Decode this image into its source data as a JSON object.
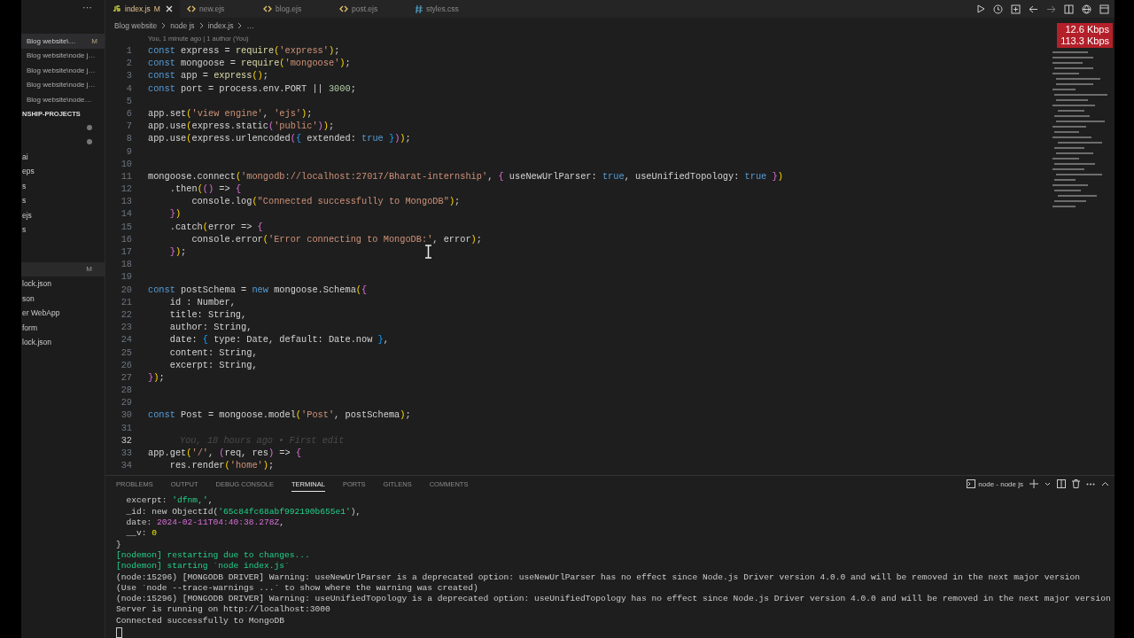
{
  "sidebar": {
    "more": "···",
    "open_editors": [
      {
        "label": "Blog website\\…",
        "badge": "M",
        "selected": true
      },
      {
        "label": "Blog website\\node j…",
        "selected": false
      },
      {
        "label": "Blog website\\node j…",
        "selected": false
      },
      {
        "label": "Blog website\\node j…",
        "selected": false
      },
      {
        "label": "Blog website\\node…",
        "selected": false
      }
    ],
    "section": "NSHIP-PROJECTS",
    "items": [
      {
        "kind": "dot"
      },
      {
        "kind": "dot"
      },
      {
        "kind": "file",
        "label": "ai"
      },
      {
        "kind": "file",
        "label": "eps"
      },
      {
        "kind": "file",
        "label": "s"
      },
      {
        "kind": "file",
        "label": "s"
      },
      {
        "kind": "file",
        "label": "ejs"
      },
      {
        "kind": "file",
        "label": "s"
      },
      {
        "kind": "header",
        "badge": "M"
      },
      {
        "kind": "file",
        "label": "lock.json"
      },
      {
        "kind": "file",
        "label": "son"
      },
      {
        "kind": "file",
        "label": "er WebApp"
      },
      {
        "kind": "file",
        "label": "form"
      },
      {
        "kind": "file",
        "label": "lock.json"
      }
    ]
  },
  "tabs": [
    {
      "label": "index.js",
      "kind": "js",
      "badge": "M",
      "selected": true
    },
    {
      "label": "new.ejs",
      "kind": "ejs",
      "selected": false
    },
    {
      "label": "blog.ejs",
      "kind": "ejs",
      "selected": false
    },
    {
      "label": "post.ejs",
      "kind": "ejs",
      "selected": false
    },
    {
      "label": "styles.css",
      "kind": "css",
      "selected": false
    }
  ],
  "breadcrumb": [
    "Blog website",
    "node js",
    "index.js",
    "…"
  ],
  "codelens": "You, 1 minute ago | 1 author (You)",
  "code": [
    {
      "n": "1",
      "t": [
        {
          "kind": "kw",
          "text": "const "
        },
        {
          "kind": "v",
          "text": "express"
        },
        {
          "kind": "p",
          "text": " = "
        },
        {
          "kind": "fn",
          "text": "require"
        },
        {
          "kind": "b",
          "text": "("
        },
        {
          "kind": "s",
          "text": "'express'"
        },
        {
          "kind": "b",
          "text": ")"
        },
        {
          "kind": "p",
          "text": ";"
        }
      ]
    },
    {
      "n": "2",
      "t": [
        {
          "kind": "kw",
          "text": "const "
        },
        {
          "kind": "v",
          "text": "mongoose"
        },
        {
          "kind": "p",
          "text": " = "
        },
        {
          "kind": "fn",
          "text": "require"
        },
        {
          "kind": "b",
          "text": "("
        },
        {
          "kind": "s",
          "text": "'mongoose'"
        },
        {
          "kind": "b",
          "text": ")"
        },
        {
          "kind": "p",
          "text": ";"
        }
      ]
    },
    {
      "n": "3",
      "t": [
        {
          "kind": "kw",
          "text": "const "
        },
        {
          "kind": "v",
          "text": "app"
        },
        {
          "kind": "p",
          "text": " = "
        },
        {
          "kind": "fn",
          "text": "express"
        },
        {
          "kind": "b",
          "text": "()"
        },
        {
          "kind": "p",
          "text": ";"
        }
      ]
    },
    {
      "n": "4",
      "t": [
        {
          "kind": "kw",
          "text": "const "
        },
        {
          "kind": "v",
          "text": "port"
        },
        {
          "kind": "p",
          "text": " = process.env.PORT || "
        },
        {
          "kind": "num",
          "text": "3000"
        },
        {
          "kind": "p",
          "text": ";"
        }
      ]
    },
    {
      "n": "5"
    },
    {
      "n": "6",
      "t": [
        {
          "kind": "p",
          "text": "app.set"
        },
        {
          "kind": "b",
          "text": "("
        },
        {
          "kind": "s",
          "text": "'view engine'"
        },
        {
          "kind": "p",
          "text": ", "
        },
        {
          "kind": "s",
          "text": "'ejs'"
        },
        {
          "kind": "b",
          "text": ")"
        },
        {
          "kind": "p",
          "text": ";"
        }
      ]
    },
    {
      "n": "7",
      "t": [
        {
          "kind": "p",
          "text": "app.use"
        },
        {
          "kind": "b",
          "text": "("
        },
        {
          "kind": "p",
          "text": "express.static"
        },
        {
          "kind": "pk",
          "text": "("
        },
        {
          "kind": "s",
          "text": "'public'"
        },
        {
          "kind": "pk",
          "text": ")"
        },
        {
          "kind": "b",
          "text": ")"
        },
        {
          "kind": "p",
          "text": ";"
        }
      ]
    },
    {
      "n": "8",
      "t": [
        {
          "kind": "p",
          "text": "app.use"
        },
        {
          "kind": "b",
          "text": "("
        },
        {
          "kind": "p",
          "text": "express.urlencoded"
        },
        {
          "kind": "pk",
          "text": "("
        },
        {
          "kind": "bl",
          "text": "{"
        },
        {
          "kind": "p",
          "text": " extended: "
        },
        {
          "kind": "kw",
          "text": "true"
        },
        {
          "kind": "bl",
          "text": " }"
        },
        {
          "kind": "pk",
          "text": ")"
        },
        {
          "kind": "b",
          "text": ")"
        },
        {
          "kind": "p",
          "text": ";"
        }
      ]
    },
    {
      "n": "9"
    },
    {
      "n": "10"
    },
    {
      "n": "11",
      "t": [
        {
          "kind": "p",
          "text": "mongoose.connect"
        },
        {
          "kind": "b",
          "text": "("
        },
        {
          "kind": "s",
          "text": "'mongodb://localhost:27017/Bharat-internship'"
        },
        {
          "kind": "p",
          "text": ", "
        },
        {
          "kind": "pk",
          "text": "{"
        },
        {
          "kind": "p",
          "text": " useNewUrlParser: "
        },
        {
          "kind": "kw",
          "text": "true"
        },
        {
          "kind": "p",
          "text": ", useUnifiedTopology: "
        },
        {
          "kind": "kw",
          "text": "true"
        },
        {
          "kind": "pk",
          "text": " }"
        },
        {
          "kind": "b",
          "text": ")"
        }
      ]
    },
    {
      "n": "12",
      "t": [
        {
          "kind": "p",
          "text": "    .then"
        },
        {
          "kind": "b",
          "text": "("
        },
        {
          "kind": "pk",
          "text": "()"
        },
        {
          "kind": "p",
          "text": " => "
        },
        {
          "kind": "pk",
          "text": "{"
        }
      ]
    },
    {
      "n": "13",
      "t": [
        {
          "kind": "p",
          "text": "        console.log"
        },
        {
          "kind": "b",
          "text": "("
        },
        {
          "kind": "s",
          "text": "\"Connected successfully to MongoDB\""
        },
        {
          "kind": "b",
          "text": ")"
        },
        {
          "kind": "p",
          "text": ";"
        }
      ]
    },
    {
      "n": "14",
      "t": [
        {
          "kind": "pk",
          "text": "    }"
        },
        {
          "kind": "b",
          "text": ")"
        }
      ]
    },
    {
      "n": "15",
      "t": [
        {
          "kind": "p",
          "text": "    .catch"
        },
        {
          "kind": "b",
          "text": "("
        },
        {
          "kind": "p",
          "text": "error => "
        },
        {
          "kind": "pk",
          "text": "{"
        }
      ]
    },
    {
      "n": "16",
      "t": [
        {
          "kind": "p",
          "text": "        console.error"
        },
        {
          "kind": "b",
          "text": "("
        },
        {
          "kind": "s",
          "text": "'Error connecting to MongoDB:'"
        },
        {
          "kind": "p",
          "text": ", error"
        },
        {
          "kind": "b",
          "text": ")"
        },
        {
          "kind": "p",
          "text": ";"
        }
      ]
    },
    {
      "n": "17",
      "t": [
        {
          "kind": "pk",
          "text": "    }"
        },
        {
          "kind": "b",
          "text": ")"
        },
        {
          "kind": "p",
          "text": ";"
        }
      ]
    },
    {
      "n": "18"
    },
    {
      "n": "19"
    },
    {
      "n": "20",
      "t": [
        {
          "kind": "kw",
          "text": "const "
        },
        {
          "kind": "v",
          "text": "postSchema"
        },
        {
          "kind": "p",
          "text": " = "
        },
        {
          "kind": "kw",
          "text": "new "
        },
        {
          "kind": "p",
          "text": "mongoose.Schema"
        },
        {
          "kind": "b",
          "text": "("
        },
        {
          "kind": "pk",
          "text": "{"
        }
      ]
    },
    {
      "n": "21",
      "t": [
        {
          "kind": "p",
          "text": "    id : Number,"
        }
      ]
    },
    {
      "n": "22",
      "t": [
        {
          "kind": "p",
          "text": "    title: String,"
        }
      ]
    },
    {
      "n": "23",
      "t": [
        {
          "kind": "p",
          "text": "    author: String,"
        }
      ]
    },
    {
      "n": "24",
      "t": [
        {
          "kind": "p",
          "text": "    date: "
        },
        {
          "kind": "bl",
          "text": "{"
        },
        {
          "kind": "p",
          "text": " type: Date, default: Date.now "
        },
        {
          "kind": "bl",
          "text": "}"
        },
        {
          "kind": "p",
          "text": ","
        }
      ]
    },
    {
      "n": "25",
      "t": [
        {
          "kind": "p",
          "text": "    content: String,"
        }
      ]
    },
    {
      "n": "26",
      "t": [
        {
          "kind": "p",
          "text": "    excerpt: String,"
        }
      ]
    },
    {
      "n": "27",
      "t": [
        {
          "kind": "pk",
          "text": "}"
        },
        {
          "kind": "b",
          "text": ")"
        },
        {
          "kind": "p",
          "text": ";"
        }
      ]
    },
    {
      "n": "28"
    },
    {
      "n": "29"
    },
    {
      "n": "30",
      "t": [
        {
          "kind": "kw",
          "text": "const "
        },
        {
          "kind": "v",
          "text": "Post"
        },
        {
          "kind": "p",
          "text": " = mongoose.model"
        },
        {
          "kind": "b",
          "text": "("
        },
        {
          "kind": "s",
          "text": "'Post'"
        },
        {
          "kind": "p",
          "text": ", postSchema"
        },
        {
          "kind": "b",
          "text": ")"
        },
        {
          "kind": "p",
          "text": ";"
        }
      ]
    },
    {
      "n": "31"
    },
    {
      "n": "32",
      "blame": "You, 18 hours ago • First edit",
      "current": true
    },
    {
      "n": "33",
      "t": [
        {
          "kind": "p",
          "text": "app.get"
        },
        {
          "kind": "b",
          "text": "("
        },
        {
          "kind": "s",
          "text": "'/'"
        },
        {
          "kind": "p",
          "text": ", "
        },
        {
          "kind": "pk",
          "text": "("
        },
        {
          "kind": "p",
          "text": "req, res"
        },
        {
          "kind": "pk",
          "text": ")"
        },
        {
          "kind": "p",
          "text": " => "
        },
        {
          "kind": "pk",
          "text": "{"
        }
      ]
    },
    {
      "n": "34",
      "t": [
        {
          "kind": "p",
          "text": "    res.render"
        },
        {
          "kind": "b",
          "text": "("
        },
        {
          "kind": "s",
          "text": "'home'"
        },
        {
          "kind": "b",
          "text": ")"
        },
        {
          "kind": "p",
          "text": ";"
        }
      ]
    }
  ],
  "network": [
    "12.6 Kbps",
    "113.3 Kbps"
  ],
  "panel": {
    "tabs": [
      {
        "label": "PROBLEMS",
        "selected": false
      },
      {
        "label": "OUTPUT",
        "selected": false
      },
      {
        "label": "DEBUG CONSOLE",
        "selected": false
      },
      {
        "label": "TERMINAL",
        "selected": true
      },
      {
        "label": "PORTS",
        "selected": false
      },
      {
        "label": "GITLENS",
        "selected": false
      },
      {
        "label": "COMMENTS",
        "selected": false
      }
    ],
    "terminal_name": "node - node js",
    "lines": [
      [
        {
          "kind": "p",
          "text": "  excerpt: "
        },
        {
          "kind": "g",
          "text": "'dfnm,'"
        },
        {
          "kind": "p",
          "text": ","
        }
      ],
      [
        {
          "kind": "p",
          "text": "  _id: new ObjectId("
        },
        {
          "kind": "g",
          "text": "'65c84fc68abf992190b655e1'"
        },
        {
          "kind": "p",
          "text": "),"
        }
      ],
      [
        {
          "kind": "p",
          "text": "  date: "
        },
        {
          "kind": "m",
          "text": "2024-02-11T04:40:38.278Z"
        },
        {
          "kind": "p",
          "text": ","
        }
      ],
      [
        {
          "kind": "p",
          "text": "  __v: "
        },
        {
          "kind": "y",
          "text": "0"
        }
      ],
      [
        {
          "kind": "p",
          "text": "}"
        }
      ],
      [
        {
          "kind": "g",
          "text": "[nodemon] restarting due to changes..."
        }
      ],
      [
        {
          "kind": "g",
          "text": "[nodemon] starting `node index.js`"
        }
      ],
      [
        {
          "kind": "p",
          "text": "(node:15296) [MONGODB DRIVER] Warning: useNewUrlParser is a deprecated option: useNewUrlParser has no effect since Node.js Driver version 4.0.0 and will be removed in the next major version"
        }
      ],
      [
        {
          "kind": "p",
          "text": "(Use `node --trace-warnings ...` to show where the warning was created)"
        }
      ],
      [
        {
          "kind": "p",
          "text": "(node:15296) [MONGODB DRIVER] Warning: useUnifiedTopology is a deprecated option: useUnifiedTopology has no effect since Node.js Driver version 4.0.0 and will be removed in the next major version"
        }
      ],
      [
        {
          "kind": "p",
          "text": "Server is running on http://localhost:3000"
        }
      ],
      [
        {
          "kind": "p",
          "text": "Connected successfully to MongoDB"
        }
      ]
    ]
  }
}
